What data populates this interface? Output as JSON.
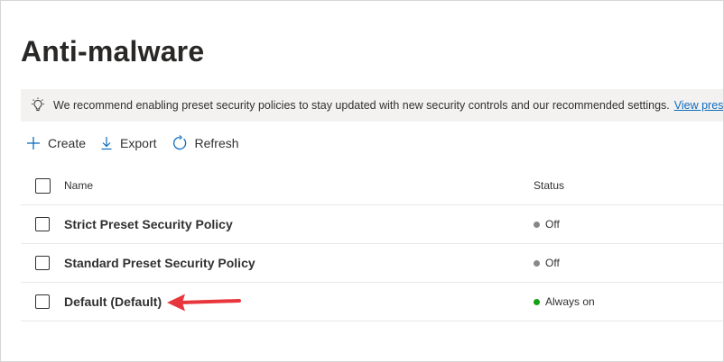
{
  "page": {
    "title": "Anti-malware"
  },
  "banner": {
    "icon": "lightbulb-icon",
    "message": "We recommend enabling preset security policies to stay updated with new security controls and our recommended settings.",
    "link_text": "View preset security policies"
  },
  "toolbar": {
    "create_label": "Create",
    "export_label": "Export",
    "refresh_label": "Refresh"
  },
  "table": {
    "columns": {
      "name": "Name",
      "status": "Status"
    },
    "rows": [
      {
        "name": "Strict Preset Security Policy",
        "status": "Off",
        "status_color": "#8a8886"
      },
      {
        "name": "Standard Preset Security Policy",
        "status": "Off",
        "status_color": "#8a8886"
      },
      {
        "name": "Default (Default)",
        "status": "Always on",
        "status_color": "#13a10e"
      }
    ]
  },
  "colors": {
    "accent": "#0f6cbd",
    "annotation_arrow": "#e8363d"
  }
}
